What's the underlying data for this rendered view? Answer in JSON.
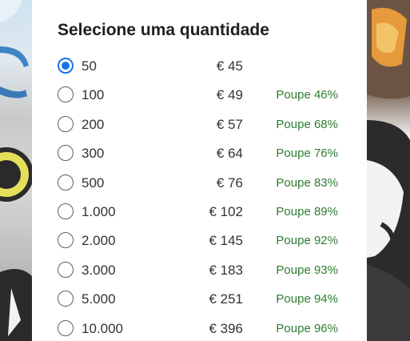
{
  "title": "Selecione uma quantidade",
  "options": [
    {
      "quantity": "50",
      "price": "€ 45",
      "savings": "",
      "selected": true
    },
    {
      "quantity": "100",
      "price": "€ 49",
      "savings": "Poupe 46%",
      "selected": false
    },
    {
      "quantity": "200",
      "price": "€ 57",
      "savings": "Poupe 68%",
      "selected": false
    },
    {
      "quantity": "300",
      "price": "€ 64",
      "savings": "Poupe 76%",
      "selected": false
    },
    {
      "quantity": "500",
      "price": "€ 76",
      "savings": "Poupe 83%",
      "selected": false
    },
    {
      "quantity": "1.000",
      "price": "€ 102",
      "savings": "Poupe 89%",
      "selected": false
    },
    {
      "quantity": "2.000",
      "price": "€ 145",
      "savings": "Poupe 92%",
      "selected": false
    },
    {
      "quantity": "3.000",
      "price": "€ 183",
      "savings": "Poupe 93%",
      "selected": false
    },
    {
      "quantity": "5.000",
      "price": "€ 251",
      "savings": "Poupe 94%",
      "selected": false
    },
    {
      "quantity": "10.000",
      "price": "€ 396",
      "savings": "Poupe 96%",
      "selected": false
    }
  ],
  "colors": {
    "accent": "#1a73e8",
    "savings": "#2e7d32",
    "text": "#333333"
  }
}
